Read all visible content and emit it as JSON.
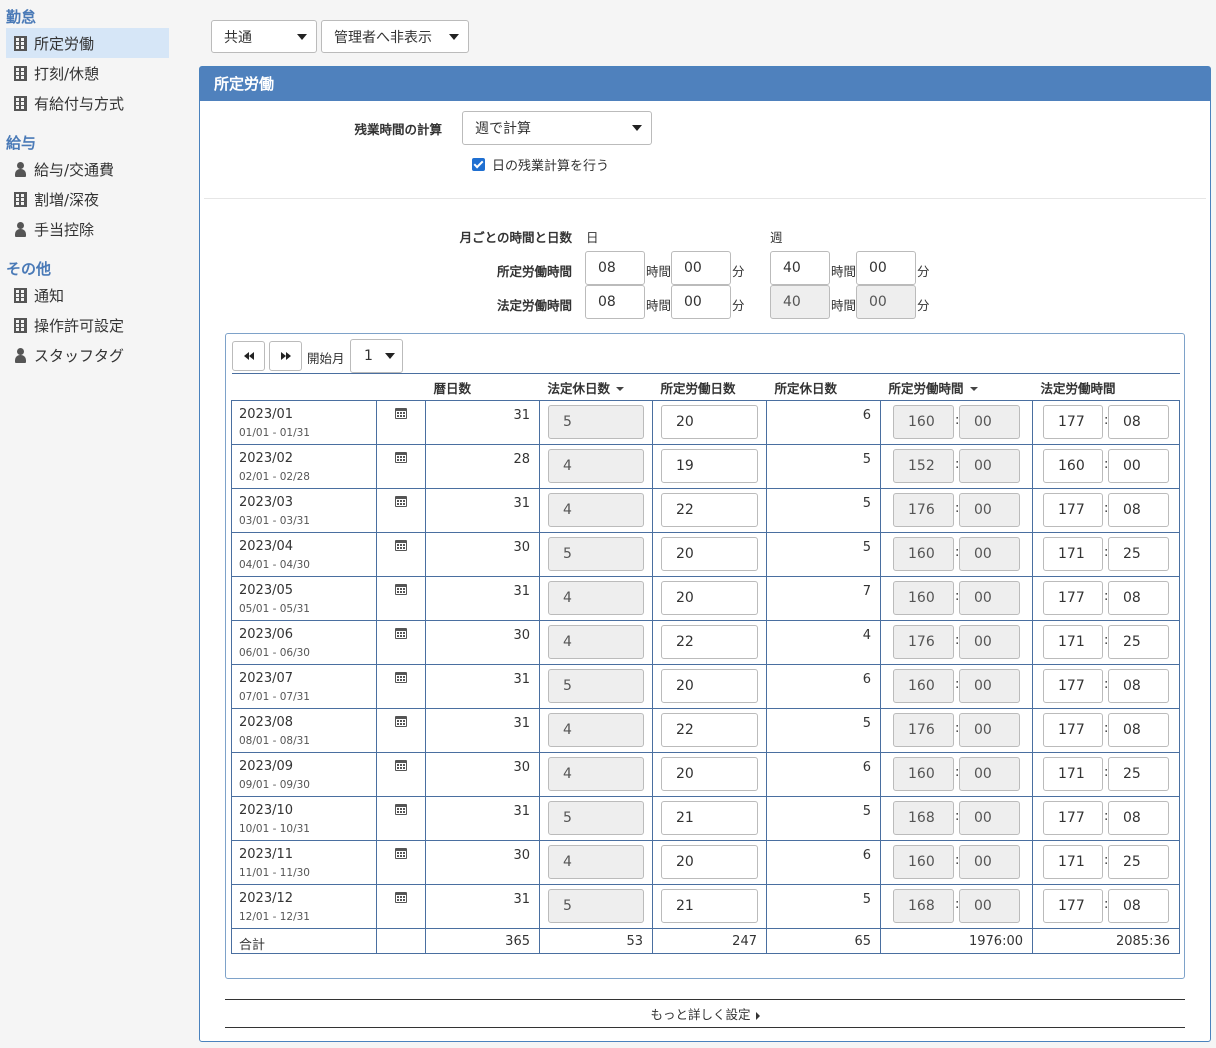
{
  "sidebar": {
    "sections": [
      {
        "title": "勤怠",
        "items": [
          {
            "label": "所定労働",
            "icon": "building-icon",
            "active": true
          },
          {
            "label": "打刻/休憩",
            "icon": "building-icon"
          },
          {
            "label": "有給付与方式",
            "icon": "building-icon"
          }
        ]
      },
      {
        "title": "給与",
        "items": [
          {
            "label": "給与/交通費",
            "icon": "person-icon"
          },
          {
            "label": "割増/深夜",
            "icon": "building-icon"
          },
          {
            "label": "手当控除",
            "icon": "person-icon"
          }
        ]
      },
      {
        "title": "その他",
        "items": [
          {
            "label": "通知",
            "icon": "building-icon"
          },
          {
            "label": "操作許可設定",
            "icon": "building-icon"
          },
          {
            "label": "スタッフタグ",
            "icon": "person-icon"
          }
        ]
      }
    ]
  },
  "topbar": {
    "scope_select": "共通",
    "visibility_select": "管理者へ非表示"
  },
  "panel": {
    "title": "所定労働",
    "overtime_label": "残業時間の計算",
    "overtime_select": "週で計算",
    "daily_checkbox_label": "日の残業計算を行う",
    "monthly_label": "月ごとの時間と日数",
    "day_label": "日",
    "week_label": "週",
    "scheduled_label": "所定労働時間",
    "legal_label": "法定労働時間",
    "hour_unit": "時間",
    "minute_unit": "分",
    "scheduled_day": {
      "h": "08",
      "m": "00"
    },
    "scheduled_week": {
      "h": "40",
      "m": "00"
    },
    "legal_day": {
      "h": "08",
      "m": "00"
    },
    "legal_week": {
      "h": "40",
      "m": "00"
    },
    "start_month_label": "開始月",
    "start_month_value": "1",
    "more_link": "もっと詳しく設定"
  },
  "table": {
    "headers": [
      "",
      "",
      "暦日数",
      "法定休日数",
      "所定労働日数",
      "所定休日数",
      "所定労働時間",
      "法定労働時間"
    ],
    "rows": [
      {
        "month": "2023/01",
        "range": "01/01 - 01/31",
        "cal_days": "31",
        "legal_holidays": "5",
        "work_days": "20",
        "sched_holidays": "6",
        "sched_h": "160",
        "sched_m": "00",
        "legal_h": "177",
        "legal_m": "08"
      },
      {
        "month": "2023/02",
        "range": "02/01 - 02/28",
        "cal_days": "28",
        "legal_holidays": "4",
        "work_days": "19",
        "sched_holidays": "5",
        "sched_h": "152",
        "sched_m": "00",
        "legal_h": "160",
        "legal_m": "00"
      },
      {
        "month": "2023/03",
        "range": "03/01 - 03/31",
        "cal_days": "31",
        "legal_holidays": "4",
        "work_days": "22",
        "sched_holidays": "5",
        "sched_h": "176",
        "sched_m": "00",
        "legal_h": "177",
        "legal_m": "08"
      },
      {
        "month": "2023/04",
        "range": "04/01 - 04/30",
        "cal_days": "30",
        "legal_holidays": "5",
        "work_days": "20",
        "sched_holidays": "5",
        "sched_h": "160",
        "sched_m": "00",
        "legal_h": "171",
        "legal_m": "25"
      },
      {
        "month": "2023/05",
        "range": "05/01 - 05/31",
        "cal_days": "31",
        "legal_holidays": "4",
        "work_days": "20",
        "sched_holidays": "7",
        "sched_h": "160",
        "sched_m": "00",
        "legal_h": "177",
        "legal_m": "08"
      },
      {
        "month": "2023/06",
        "range": "06/01 - 06/30",
        "cal_days": "30",
        "legal_holidays": "4",
        "work_days": "22",
        "sched_holidays": "4",
        "sched_h": "176",
        "sched_m": "00",
        "legal_h": "171",
        "legal_m": "25"
      },
      {
        "month": "2023/07",
        "range": "07/01 - 07/31",
        "cal_days": "31",
        "legal_holidays": "5",
        "work_days": "20",
        "sched_holidays": "6",
        "sched_h": "160",
        "sched_m": "00",
        "legal_h": "177",
        "legal_m": "08"
      },
      {
        "month": "2023/08",
        "range": "08/01 - 08/31",
        "cal_days": "31",
        "legal_holidays": "4",
        "work_days": "22",
        "sched_holidays": "5",
        "sched_h": "176",
        "sched_m": "00",
        "legal_h": "177",
        "legal_m": "08"
      },
      {
        "month": "2023/09",
        "range": "09/01 - 09/30",
        "cal_days": "30",
        "legal_holidays": "4",
        "work_days": "20",
        "sched_holidays": "6",
        "sched_h": "160",
        "sched_m": "00",
        "legal_h": "171",
        "legal_m": "25"
      },
      {
        "month": "2023/10",
        "range": "10/01 - 10/31",
        "cal_days": "31",
        "legal_holidays": "5",
        "work_days": "21",
        "sched_holidays": "5",
        "sched_h": "168",
        "sched_m": "00",
        "legal_h": "177",
        "legal_m": "08"
      },
      {
        "month": "2023/11",
        "range": "11/01 - 11/30",
        "cal_days": "30",
        "legal_holidays": "4",
        "work_days": "20",
        "sched_holidays": "6",
        "sched_h": "160",
        "sched_m": "00",
        "legal_h": "171",
        "legal_m": "25"
      },
      {
        "month": "2023/12",
        "range": "12/01 - 12/31",
        "cal_days": "31",
        "legal_holidays": "5",
        "work_days": "21",
        "sched_holidays": "5",
        "sched_h": "168",
        "sched_m": "00",
        "legal_h": "177",
        "legal_m": "08"
      }
    ],
    "total": {
      "label": "合計",
      "cal_days": "365",
      "legal_holidays": "53",
      "work_days": "247",
      "sched_holidays": "65",
      "sched_time": "1976:00",
      "legal_time": "2085:36"
    }
  },
  "colors": {
    "accent": "#4f81bd",
    "active_bg": "#d6e6f7",
    "section_title": "#4a7ab7"
  }
}
